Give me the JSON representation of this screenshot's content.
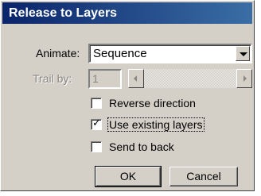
{
  "window": {
    "title": "Release to Layers"
  },
  "form": {
    "animate_label": "Animate:",
    "animate_value": "Sequence",
    "trail_label": "Trail by:",
    "trail_value": "1"
  },
  "options": [
    {
      "label": "Reverse direction",
      "checked": false
    },
    {
      "label": "Use existing layers",
      "checked": true
    },
    {
      "label": "Send to back",
      "checked": false
    }
  ],
  "buttons": {
    "ok": "OK",
    "cancel": "Cancel"
  },
  "icons": {
    "dropdown": "chevron-down-icon",
    "scroll_left": "arrow-left-icon",
    "scroll_right": "arrow-right-icon",
    "checkmark": "checkmark-icon"
  },
  "colors": {
    "titlebar": "#0a246a",
    "face": "#d4d0c8"
  }
}
